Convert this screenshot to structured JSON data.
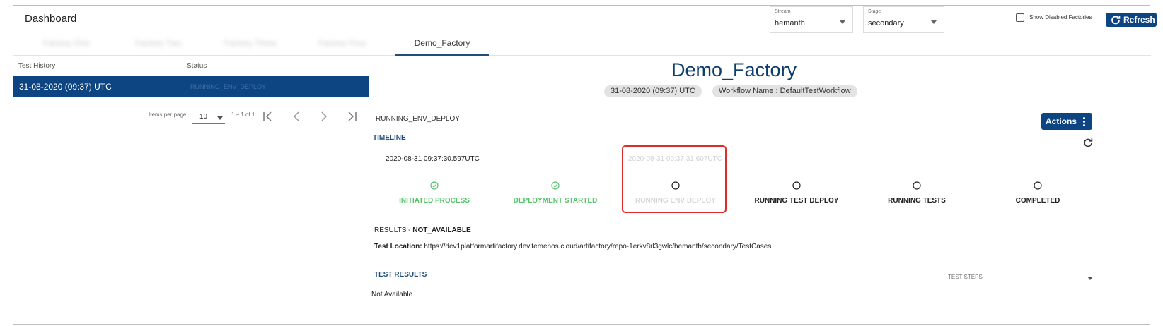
{
  "header": {
    "title": "Dashboard",
    "tabs": [
      {
        "label": "Factory One"
      },
      {
        "label": "Factory Two"
      },
      {
        "label": "Factory Three"
      },
      {
        "label": "Factory Four"
      },
      {
        "label": "Demo_Factory"
      }
    ],
    "stream": {
      "label": "Stream",
      "value": "hemanth"
    },
    "stage": {
      "label": "Stage",
      "value": "secondary"
    },
    "show_disabled_label": "Show Disabled Factories",
    "refresh_label": "Refresh"
  },
  "left_panel": {
    "col_history": "Test History",
    "col_status": "Status",
    "rows": [
      {
        "date": "31-08-2020 (09:37) UTC",
        "status": "RUNNING_ENV_DEPLOY"
      }
    ],
    "paginator": {
      "items_per_page_label": "Items per page:",
      "page_size": "10",
      "range": "1 – 1 of 1"
    }
  },
  "detail": {
    "factory_name": "Demo_Factory",
    "chip_date": "31-08-2020 (09:37) UTC",
    "chip_workflow": "Workflow Name : DefaultTestWorkflow",
    "current_status": "RUNNING_ENV_DEPLOY",
    "actions_label": "Actions",
    "timeline_title": "TIMELINE",
    "timestamps": [
      "2020-08-31 09:37:30.597UTC",
      "2020-08-31 09:37:31.607UTC"
    ],
    "steps": [
      {
        "label": "INITIATED PROCESS",
        "state": "done"
      },
      {
        "label": "DEPLOYMENT STARTED",
        "state": "done"
      },
      {
        "label": "RUNNING ENV DEPLOY",
        "state": "current"
      },
      {
        "label": "RUNNING TEST DEPLOY",
        "state": "pending"
      },
      {
        "label": "RUNNING TESTS",
        "state": "pending"
      },
      {
        "label": "COMPLETED",
        "state": "pending"
      }
    ],
    "results_label": "RESULTS - ",
    "results_value": "NOT_AVAILABLE",
    "test_location_label": "Test Location: ",
    "test_location_value": "https://dev1platformartifactory.dev.temenos.cloud/artifactory/repo-1erkv8rl3gwlc/hemanth/secondary/TestCases",
    "test_results_title": "TEST RESULTS",
    "test_steps_placeholder": "TEST STEPS",
    "test_results_value": "Not Available"
  },
  "colors": {
    "primary": "#0d4582",
    "title": "#0d3c6e",
    "done": "#57c26b",
    "highlight": "#e02b2b"
  }
}
